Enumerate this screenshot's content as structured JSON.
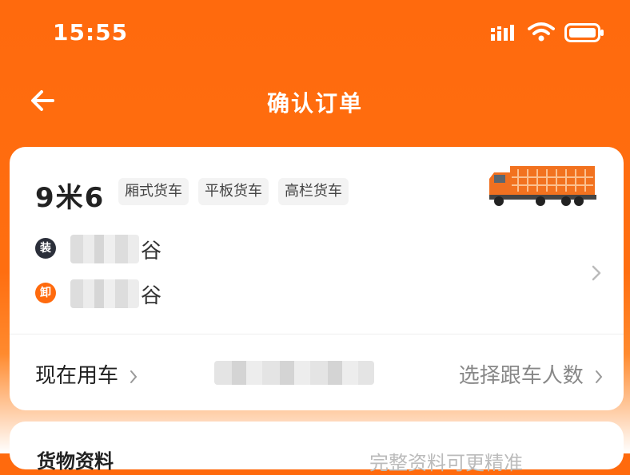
{
  "status_bar": {
    "time": "15:55"
  },
  "nav": {
    "title": "确认订单"
  },
  "vehicle": {
    "size": "9米6",
    "tags": [
      "厢式货车",
      "平板货车",
      "高栏货车"
    ]
  },
  "route": {
    "load_badge": "装",
    "load_suffix": "谷",
    "unload_badge": "卸",
    "unload_suffix": "谷"
  },
  "schedule": {
    "time_label": "现在用车",
    "companion_label": "选择跟车人数"
  },
  "goods": {
    "title": "货物资料",
    "note": "完整资料可更精准"
  },
  "colors": {
    "brand": "#ff6a0d",
    "load_badge": "#2b2f3a",
    "unload_badge": "#ff6a0d"
  }
}
